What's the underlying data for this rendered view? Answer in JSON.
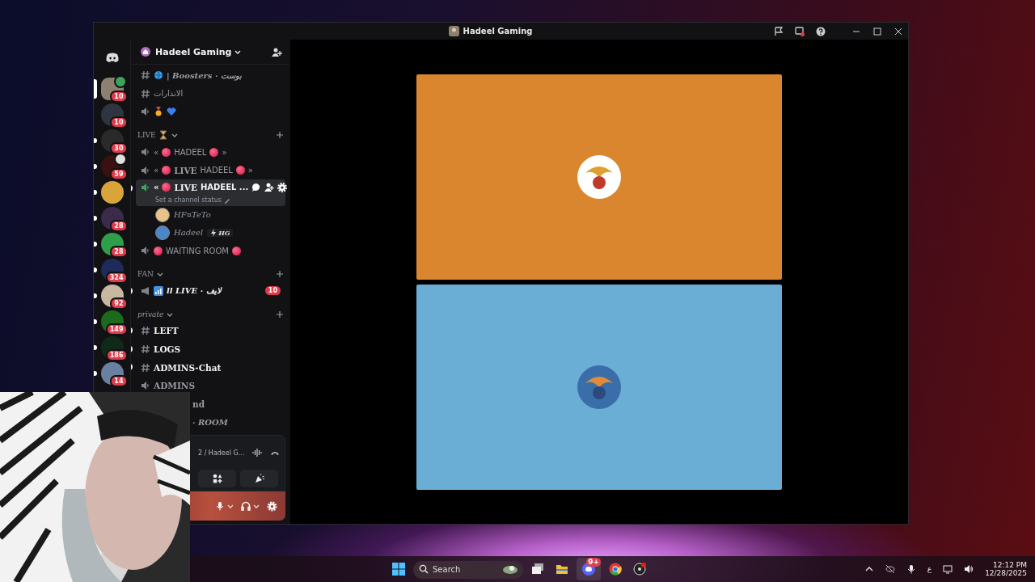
{
  "window": {
    "title": "Hadeel Gaming"
  },
  "servers": [
    {
      "badge": "10",
      "selected": true,
      "unread": false,
      "speaking": true,
      "streaming": false,
      "color": "#8d8070"
    },
    {
      "badge": "10",
      "selected": false,
      "unread": false,
      "speaking": false,
      "streaming": false,
      "color": "#2f3540"
    },
    {
      "badge": "30",
      "selected": false,
      "unread": true,
      "speaking": false,
      "streaming": false,
      "color": "#2a2a2a"
    },
    {
      "badge": "59",
      "selected": false,
      "unread": true,
      "speaking": false,
      "streaming": true,
      "color": "#3a1010"
    },
    {
      "selected": false,
      "unread": true,
      "speaking": false,
      "streaming": false,
      "color": "#d9a53a"
    },
    {
      "badge": "28",
      "selected": false,
      "unread": true,
      "speaking": false,
      "streaming": false,
      "color": "#3b2a4a"
    },
    {
      "badge": "28",
      "selected": false,
      "unread": true,
      "speaking": false,
      "streaming": false,
      "color": "#2e9e4a"
    },
    {
      "badge": "324",
      "selected": false,
      "unread": true,
      "speaking": false,
      "streaming": false,
      "color": "#1d2a5a"
    },
    {
      "badge": "92",
      "selected": false,
      "unread": true,
      "speaking": false,
      "streaming": false,
      "color": "#c8b8a0"
    },
    {
      "badge": "149",
      "selected": false,
      "unread": true,
      "speaking": false,
      "streaming": false,
      "color": "#1c6b1c"
    },
    {
      "badge": "186",
      "selected": false,
      "unread": true,
      "speaking": false,
      "streaming": false,
      "color": "#0f2a18"
    },
    {
      "badge": "14",
      "selected": false,
      "unread": true,
      "speaking": false,
      "streaming": false,
      "color": "#6a80a0"
    }
  ],
  "server_header": {
    "name": "Hadeel Gaming"
  },
  "channels": [
    {
      "kind": "text",
      "unread": false,
      "selected": false,
      "parts": [
        {
          "kind": "globe"
        },
        {
          "kind": "italic",
          "text": "| Boosters · بوست"
        }
      ]
    },
    {
      "kind": "text",
      "unread": false,
      "selected": false,
      "parts": [
        {
          "kind": "text",
          "text": "الانذارات"
        }
      ]
    },
    {
      "kind": "voice",
      "unread": false,
      "selected": false,
      "parts": [
        {
          "kind": "medal"
        },
        {
          "kind": "heart"
        }
      ]
    },
    {
      "kind": "category",
      "label": "LIVE",
      "parts": [
        {
          "kind": "hourglass"
        }
      ]
    },
    {
      "kind": "voice",
      "unread": false,
      "selected": false,
      "parts": [
        {
          "kind": "text",
          "text": "«"
        },
        {
          "kind": "dot"
        },
        {
          "kind": "text",
          "text": "HADEEL"
        },
        {
          "kind": "dot"
        },
        {
          "kind": "text",
          "text": "»"
        }
      ]
    },
    {
      "kind": "voice",
      "unread": false,
      "selected": false,
      "parts": [
        {
          "kind": "text",
          "text": "«"
        },
        {
          "kind": "dot"
        },
        {
          "kind": "serif",
          "text": "LIVE"
        },
        {
          "kind": "text",
          "text": "HADEEL"
        },
        {
          "kind": "dot"
        },
        {
          "kind": "text",
          "text": "»"
        }
      ]
    },
    {
      "kind": "voice",
      "unread": true,
      "selected": true,
      "status": "Set a channel status",
      "parts": [
        {
          "kind": "text",
          "text": "«"
        },
        {
          "kind": "dot"
        },
        {
          "kind": "serif",
          "text": "LIVE"
        },
        {
          "kind": "text",
          "text": "HADEEL ..."
        }
      ]
    },
    {
      "kind": "member",
      "name": "HF¤TeTo",
      "color": "#e8c48a"
    },
    {
      "kind": "member",
      "name": "Hadeel",
      "tag": "HG",
      "color": "#4a86c8"
    },
    {
      "kind": "voice",
      "unread": false,
      "selected": false,
      "parts": [
        {
          "kind": "dot"
        },
        {
          "kind": "text",
          "text": "WAITING ROOM"
        },
        {
          "kind": "dot"
        }
      ]
    },
    {
      "kind": "category",
      "label": "FAN"
    },
    {
      "kind": "announce",
      "unread": true,
      "selected": false,
      "badge": "10",
      "parts": [
        {
          "kind": "bars"
        },
        {
          "kind": "italic",
          "text": "ll LIVE · لايف"
        }
      ]
    },
    {
      "kind": "category",
      "label": "private"
    },
    {
      "kind": "text",
      "unread": true,
      "selected": false,
      "parts": [
        {
          "kind": "serif",
          "text": "LEFT"
        }
      ]
    },
    {
      "kind": "text",
      "unread": true,
      "selected": false,
      "parts": [
        {
          "kind": "serif",
          "text": "LOGS"
        }
      ]
    },
    {
      "kind": "text",
      "unread": true,
      "selected": false,
      "parts": [
        {
          "kind": "serif",
          "text": "ADMINS-Chat"
        }
      ]
    },
    {
      "kind": "voice",
      "unread": false,
      "selected": false,
      "parts": [
        {
          "kind": "serif",
          "text": "ADMINS"
        }
      ]
    },
    {
      "kind": "covered",
      "unread": false,
      "selected": false,
      "parts": [
        {
          "kind": "serif",
          "text": "nd"
        }
      ]
    },
    {
      "kind": "covered",
      "unread": false,
      "selected": false,
      "parts": [
        {
          "kind": "italic",
          "text": "· ROOM"
        }
      ]
    }
  ],
  "voice_panel": {
    "location": "2 / Hadeel G..."
  },
  "streams": [
    {
      "color": "#d9862e"
    },
    {
      "color": "#6aaed6"
    }
  ],
  "taskbar": {
    "search": {
      "placeholder": "Search"
    },
    "discord_badge": "9+",
    "ime": "ع",
    "time": "12:12 PM",
    "date": "12/28/2025"
  }
}
